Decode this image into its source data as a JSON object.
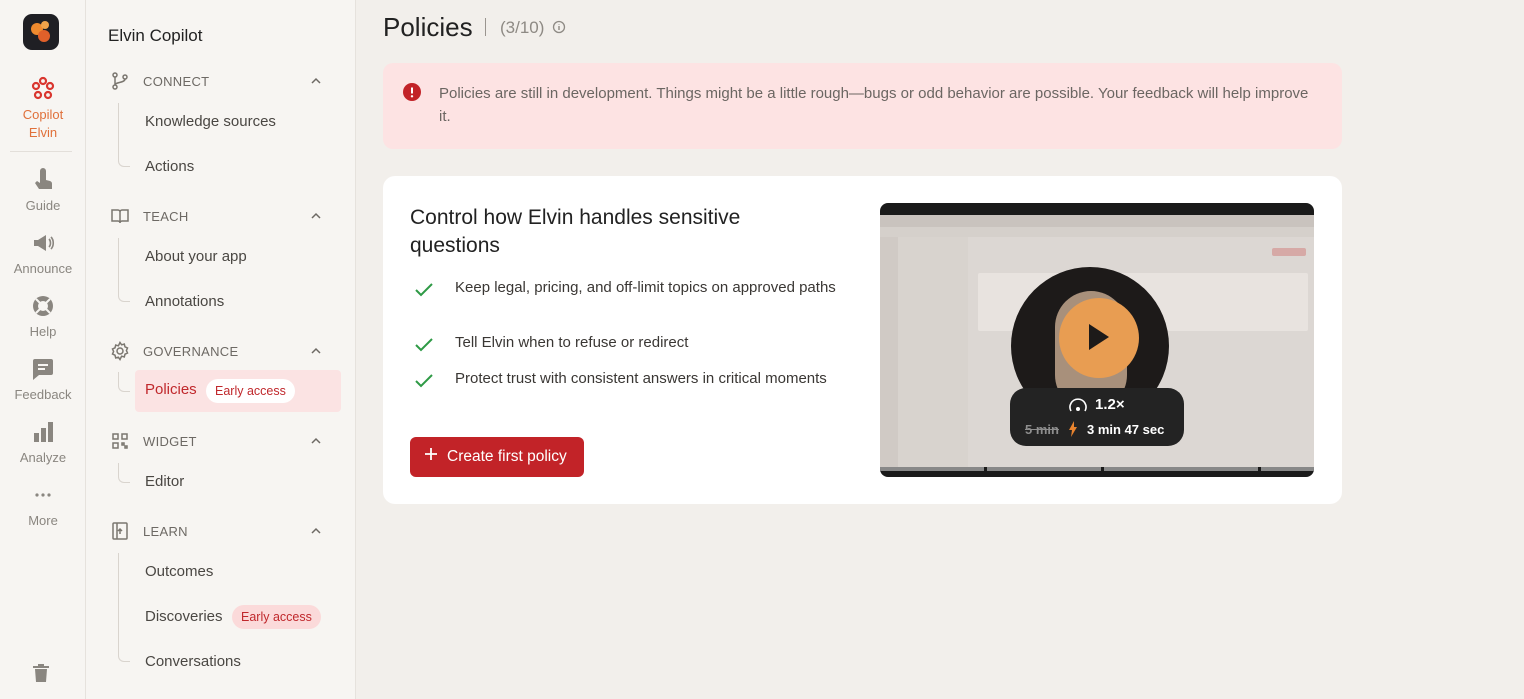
{
  "rail": {
    "items": [
      {
        "label": "Copilot Elvin",
        "icon": "copilot-icon",
        "active": true
      },
      {
        "label": "Guide",
        "icon": "guide-icon"
      },
      {
        "label": "Announce",
        "icon": "megaphone-icon"
      },
      {
        "label": "Help",
        "icon": "lifebuoy-icon"
      },
      {
        "label": "Feedback",
        "icon": "feedback-icon"
      },
      {
        "label": "Analyze",
        "icon": "bar-chart-icon"
      },
      {
        "label": "More",
        "icon": "more-icon"
      }
    ],
    "active_color": "#e0703a"
  },
  "sidebar": {
    "title": "Elvin Copilot",
    "sections": [
      {
        "label": "CONNECT",
        "icon": "branch-icon",
        "items": [
          "Knowledge sources",
          "Actions"
        ]
      },
      {
        "label": "TEACH",
        "icon": "book-icon",
        "items": [
          "About your app",
          "Annotations"
        ]
      },
      {
        "label": "GOVERNANCE",
        "icon": "gear-icon",
        "items": [
          "Policies"
        ]
      },
      {
        "label": "WIDGET",
        "icon": "grid-icon",
        "items": [
          "Editor"
        ]
      },
      {
        "label": "LEARN",
        "icon": "learn-icon",
        "items": [
          "Outcomes",
          "Discoveries",
          "Conversations"
        ]
      }
    ],
    "badges": {
      "policies": "Early access",
      "discoveries": "Early access"
    }
  },
  "main": {
    "title": "Policies",
    "count": "(3/10)",
    "alert": "Policies are still in development. Things might be a little rough—bugs or odd behavior are possible. Your feedback will help improve it.",
    "card": {
      "title": "Control how Elvin handles sensitive questions",
      "features": [
        "Keep legal, pricing, and off-limit topics on approved paths",
        "Tell Elvin when to refuse or redirect",
        "Protect trust with consistent answers in critical moments"
      ],
      "cta": "Create first policy"
    },
    "video": {
      "speed": "1.2×",
      "old_duration": "5 min",
      "new_duration": "3 min 47 sec"
    }
  },
  "colors": {
    "accent": "#c22328",
    "alert_bg": "#fde3e3",
    "check": "#2e9a46",
    "play": "#e89d52"
  }
}
